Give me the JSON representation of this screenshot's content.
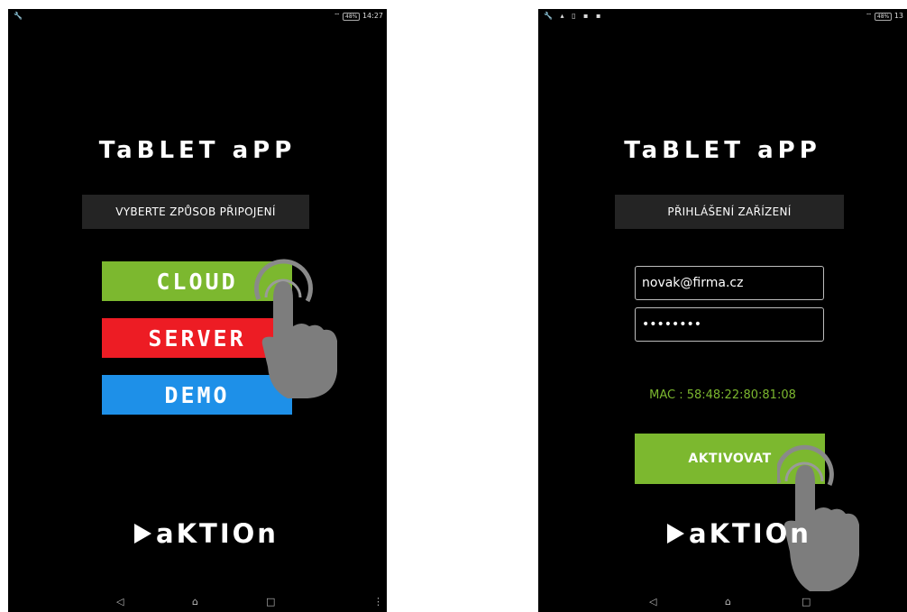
{
  "left_screen": {
    "status": {
      "left_icons": "🔧",
      "battery": "48%",
      "time": "14:27"
    },
    "title": "TaBLET aPP",
    "subtitle": "VYBERTE ZPŮSOB PŘIPOJENÍ",
    "buttons": {
      "cloud": {
        "label": "CLOUD",
        "color": "#7cb82f"
      },
      "server": {
        "label": "SERVER",
        "color": "#ed1c24"
      },
      "demo": {
        "label": "DEMO",
        "color": "#1e90e8"
      }
    },
    "logo": "aKTIOn",
    "nav": {
      "back": "◁",
      "home": "⌂",
      "recents": "□",
      "menu": "⋮"
    }
  },
  "right_screen": {
    "status": {
      "left_icons": "🔧 ▴ ▯ ▪ ▪",
      "battery": "48%",
      "time": "13"
    },
    "title": "TaBLET aPP",
    "subtitle": "PŘIHLÁŠENÍ ZAŘÍZENÍ",
    "form": {
      "email_value": "novak@firma.cz",
      "password_value": "••••••••"
    },
    "mac_text": "MAC : 58:48:22:80:81:08",
    "mac_color": "#7cb82f",
    "activate": {
      "label": "AKTIVOVAT",
      "color": "#7cb82f"
    },
    "logo": "aKTIOn",
    "nav": {
      "back": "◁",
      "home": "⌂",
      "recents": "□"
    }
  },
  "icons": [
    "wrench-icon",
    "wifi-icon",
    "battery-icon",
    "hand-pointer-icon",
    "back-icon",
    "home-icon",
    "recents-icon"
  ]
}
